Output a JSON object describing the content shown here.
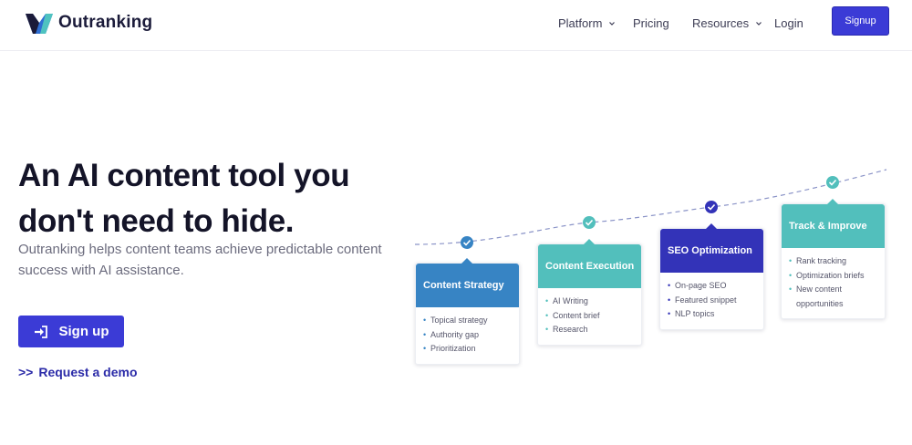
{
  "nav": {
    "brand": "Outranking",
    "items": [
      {
        "label": "Platform",
        "dropdown": true
      },
      {
        "label": "Pricing",
        "dropdown": false
      },
      {
        "label": "Resources",
        "dropdown": true
      },
      {
        "label": "Login",
        "dropdown": false
      }
    ],
    "signup_label": "Signup"
  },
  "hero": {
    "headline_line1": "An AI content tool you",
    "headline_line2": "don't need to hide.",
    "subtitle": "Outranking helps content teams achieve predictable content success with AI assistance.",
    "cta_label": "Sign up",
    "demo_prefix": ">>",
    "demo_label": "Request a demo"
  },
  "steps": [
    {
      "title": "Content Strategy",
      "color": "#3784c4",
      "items": [
        "Topical strategy",
        "Authority gap",
        "Prioritization"
      ]
    },
    {
      "title": "Content Execution",
      "color": "#52bfbc",
      "items": [
        "AI Writing",
        "Content brief",
        "Research"
      ]
    },
    {
      "title": "SEO Optimization",
      "color": "#3333b8",
      "items": [
        "On-page SEO",
        "Featured snippet",
        "NLP topics"
      ]
    },
    {
      "title": "Track & Improve",
      "color": "#52bfbc",
      "items": [
        "Rank tracking",
        "Optimization briefs",
        "New content opportunities"
      ]
    }
  ],
  "colors": {
    "accent": "#3b3bd6",
    "heading": "#141428",
    "muted_text": "#6b6b7d"
  }
}
